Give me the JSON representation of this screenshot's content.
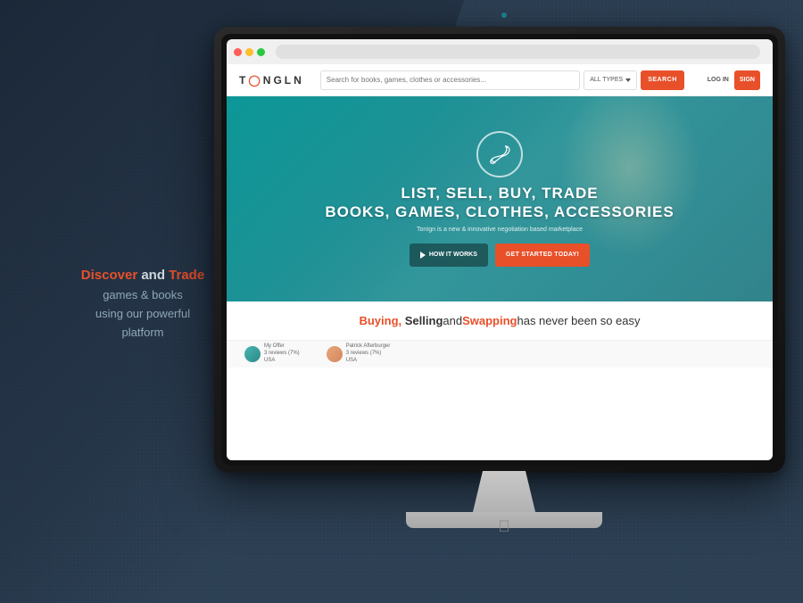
{
  "background": {
    "color": "#2e4257"
  },
  "left_panel": {
    "headline": "Discover and Trade",
    "discover_word": "Discover",
    "trade_word": "Trade",
    "line1": "games & books",
    "line2": "using our powerful",
    "line3": "platform"
  },
  "website": {
    "navbar": {
      "logo": "T○NGLN",
      "search_placeholder": "Search for books, games, clothes or accessories...",
      "dropdown_label": "ALL TYPES",
      "search_button": "SEARCH",
      "login_label": "LOG IN",
      "signup_label": "SIGN"
    },
    "hero": {
      "title_line1": "LIST, SELL, BUY, TRADE",
      "title_line2": "BOOKS, GAMES, CLOTHES, ACCESSORIES",
      "subtitle": "TonIgn is a new & innovative negotiation based marketplace",
      "btn_play": "HOW IT WORKS",
      "btn_cta": "GET STARTED TODAY!"
    },
    "selling_section": {
      "text_plain1": "",
      "buying": "Buying,",
      "selling": "Selling",
      "text_and1": " and ",
      "swapping": "Swapping",
      "text_end": " has never been so easy"
    },
    "users": [
      {
        "name": "My Offer",
        "reviews": "3 reviews (7%)",
        "location": "USA"
      },
      {
        "name": "Patrick Afterburger",
        "reviews": "3 reviews (7%)",
        "location": "USA"
      }
    ]
  },
  "browser": {
    "traffic_lights": [
      "red",
      "yellow",
      "green"
    ]
  }
}
